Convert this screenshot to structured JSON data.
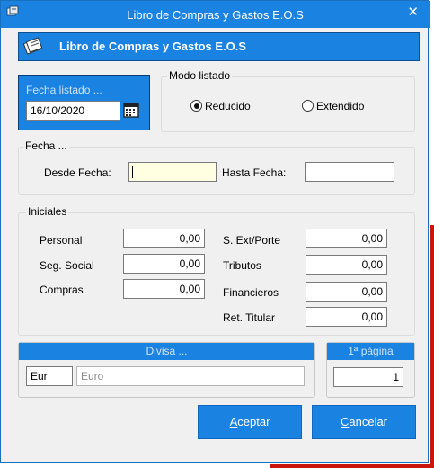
{
  "window": {
    "title": "Libro de Compras y Gastos E.O.S",
    "close_glyph": "✕"
  },
  "banner": {
    "title": "Libro de Compras y Gastos E.O.S"
  },
  "fecha_listado": {
    "label": "Fecha listado ...",
    "value": "16/10/2020"
  },
  "modo_listado": {
    "label": "Modo listado",
    "options": [
      {
        "label": "Reducido",
        "selected": true
      },
      {
        "label": "Extendido",
        "selected": false
      }
    ]
  },
  "fecha": {
    "label": "Fecha ...",
    "desde_label": "Desde Fecha:",
    "desde_value": "",
    "hasta_label": "Hasta Fecha:",
    "hasta_value": ""
  },
  "iniciales": {
    "label": "Iniciales",
    "left": [
      {
        "label": "Personal",
        "value": "0,00"
      },
      {
        "label": "Seg. Social",
        "value": "0,00"
      },
      {
        "label": "Compras",
        "value": "0,00"
      }
    ],
    "right": [
      {
        "label": "S. Ext/Porte",
        "value": "0,00"
      },
      {
        "label": "Tributos",
        "value": "0,00"
      },
      {
        "label": "Financieros",
        "value": "0,00"
      },
      {
        "label": "Ret. Titular",
        "value": "0,00"
      }
    ]
  },
  "divisa": {
    "header": "Divisa ...",
    "code": "Eur",
    "name": "Euro"
  },
  "primera_pagina": {
    "header": "1ª página",
    "value": "1"
  },
  "buttons": {
    "aceptar_mnemonic": "A",
    "aceptar_rest": "ceptar",
    "cancelar_mnemonic": "C",
    "cancelar_rest": "ancelar"
  },
  "colors": {
    "accent": "#1a82e0",
    "background": "#f0f0f0",
    "date_field_bg": "#ffffe1",
    "backdrop_red": "#c8160c"
  }
}
